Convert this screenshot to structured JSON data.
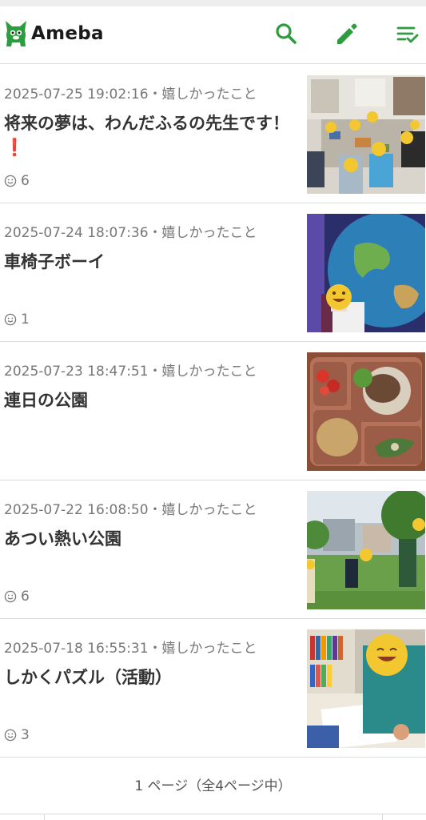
{
  "header": {
    "logo_text": "Ameba",
    "brand_color": "#2d9c3f",
    "icons": [
      "search-icon",
      "pencil-icon",
      "checklist-icon"
    ]
  },
  "entries": [
    {
      "meta": "2025-07-25 19:02:16・嬉しかったこと",
      "title": "将来の夢は、わんだふるの先生です！❗",
      "likes": "6",
      "thumb": "classroom-photo"
    },
    {
      "meta": "2025-07-24 18:07:36・嬉しかったこと",
      "title": "車椅子ボーイ",
      "likes": "1",
      "thumb": "globe-photo"
    },
    {
      "meta": "2025-07-23 18:47:51・嬉しかったこと",
      "title": "連日の公園",
      "likes": "",
      "thumb": "lunch-photo"
    },
    {
      "meta": "2025-07-22 16:08:50・嬉しかったこと",
      "title": "あつい熱い公園",
      "likes": "6",
      "thumb": "park-photo"
    },
    {
      "meta": "2025-07-18 16:55:31・嬉しかったこと",
      "title": "しかくパズル（活動）",
      "likes": "3",
      "thumb": "puzzle-photo"
    }
  ],
  "pager": {
    "label": "1 ページ（全4ページ中）"
  }
}
